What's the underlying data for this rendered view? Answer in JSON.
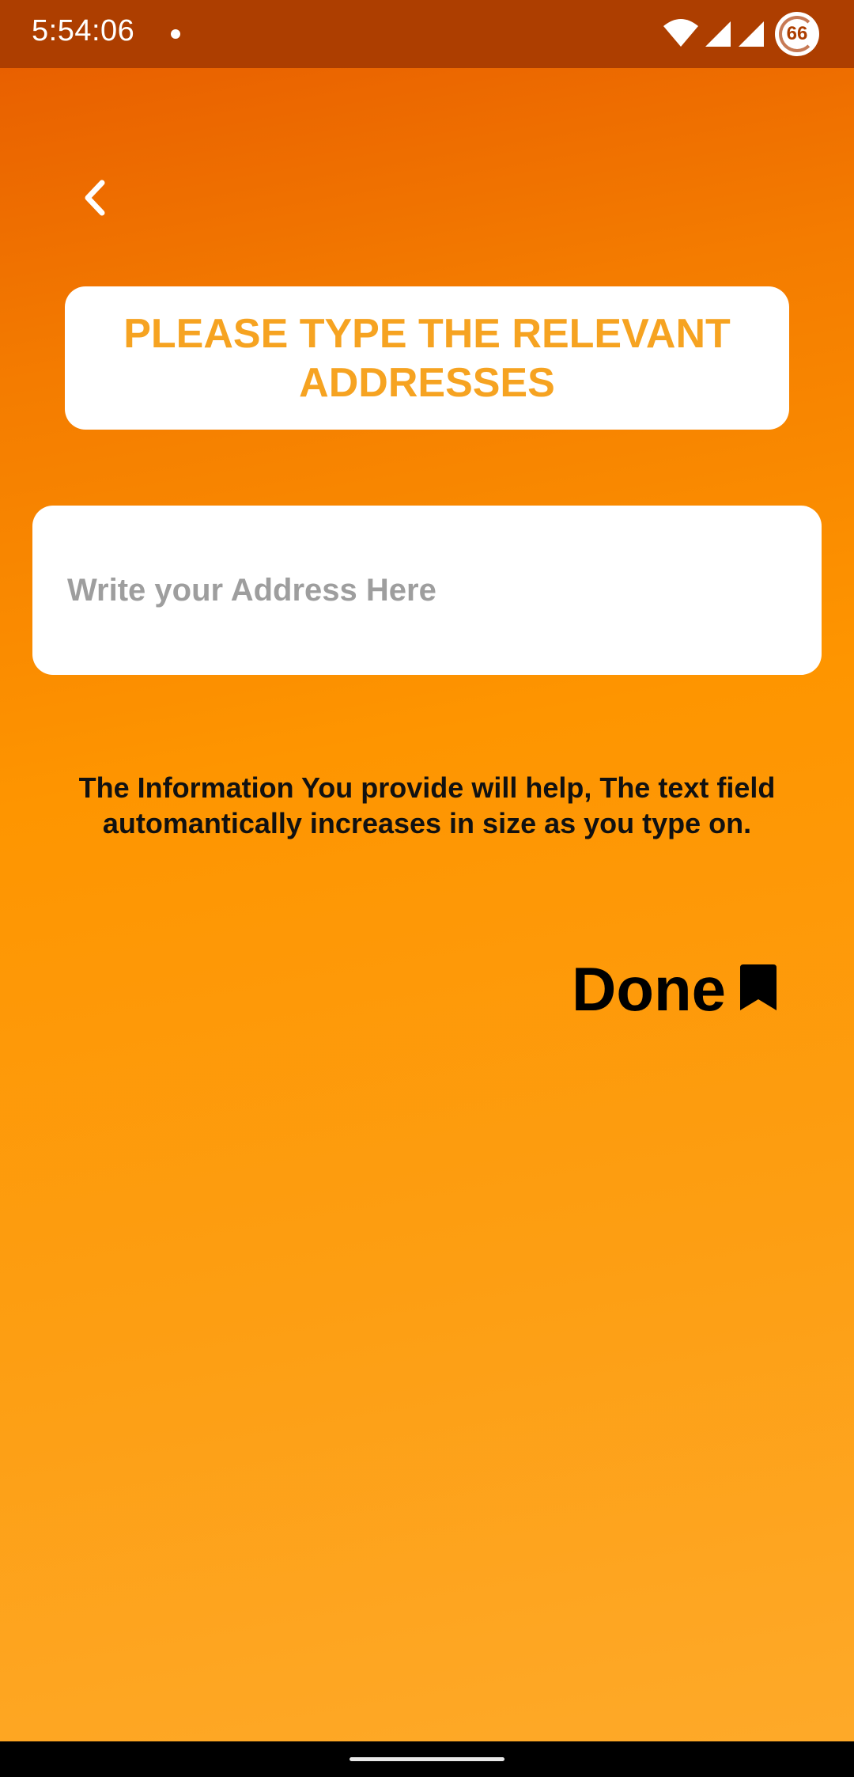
{
  "status_bar": {
    "time": "5:54:06",
    "battery": "66",
    "icons": [
      "wifi-icon",
      "cell-signal-icon",
      "cell-signal-icon",
      "battery-icon"
    ]
  },
  "header": {
    "back_icon": "chevron-left-icon"
  },
  "title": {
    "text": "PLEASE TYPE THE RELEVANT ADDRESSES"
  },
  "address_input": {
    "value": "",
    "placeholder": "Write your Address Here"
  },
  "info": {
    "text": "The Information You provide will help, The text field automantically increases in size as you type on."
  },
  "done": {
    "label": "Done",
    "icon": "bookmark-icon"
  },
  "colors": {
    "status_bar": "#ad3e00",
    "gradient_top": "#e65a00",
    "gradient_bottom": "#feaa2a",
    "title_text": "#f6a321",
    "placeholder": "#9e9e9e"
  }
}
